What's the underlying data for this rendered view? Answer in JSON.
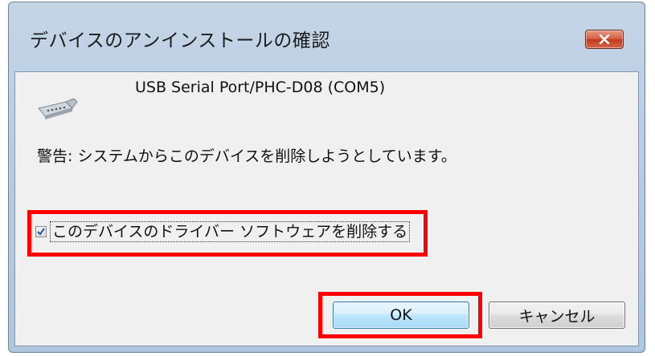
{
  "window": {
    "title": "デバイスのアンインストールの確認"
  },
  "device": {
    "name": "USB Serial Port/PHC-D08 (COM5)",
    "icon": "serial-port-connector-icon"
  },
  "warning": {
    "text": "警告: システムからこのデバイスを削除しようとしています。"
  },
  "checkbox": {
    "label": "このデバイスのドライバー ソフトウェアを削除する",
    "checked": true
  },
  "buttons": {
    "ok_label": "OK",
    "cancel_label": "キャンセル"
  },
  "colors": {
    "highlight": "#ff0000",
    "title_bar": "#b9cde2",
    "close_button": "#c0391c"
  }
}
